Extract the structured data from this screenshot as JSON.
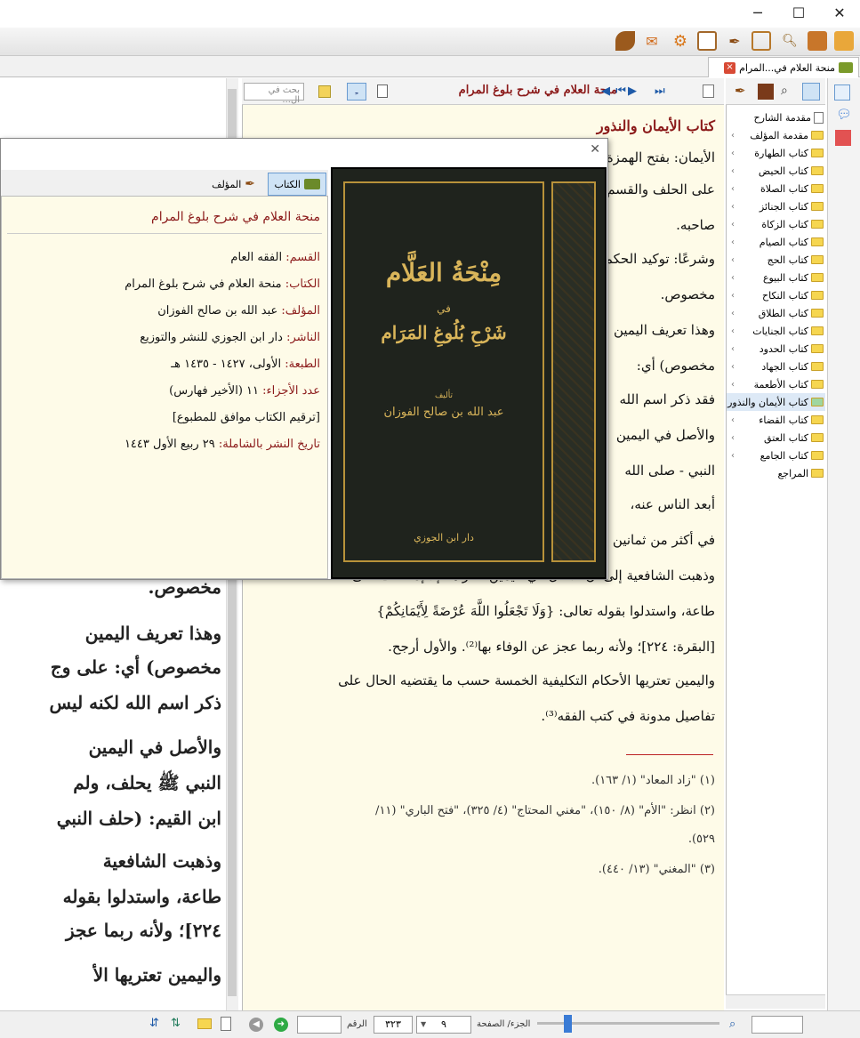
{
  "window": {
    "minimize_glyph": "─",
    "maximize_glyph": "☐",
    "close_glyph": "✕"
  },
  "toolbar": {
    "icons": [
      "book-open-icon",
      "book-icon",
      "search-icon",
      "note-edit-icon",
      "quill-icon",
      "window-list-icon",
      "gear-icon",
      "mail-icon",
      "leaf-icon"
    ]
  },
  "tab": {
    "title": "منحة العلام في...المرام",
    "close_glyph": "×"
  },
  "scan": {
    "lines": [
      "مخصوص.",
      "وهذا تعريف اليمين",
      "مخصوص) أي: على وج",
      "ذكر اسم الله لكنه ليس",
      "والأصل في اليمين",
      "النبي ﷺ يحلف، ولم",
      "ابن القيم: (حلف النبي",
      "وذهبت الشافعية",
      "طاعة، واستدلوا بقوله",
      "٢٢٤]؛ ولأنه ربما عجز",
      "واليمين تعتريها الأ"
    ]
  },
  "nav": {
    "book_title": "منحة العلام في شرح بلوغ المرام",
    "search_placeholder": "بحث في ال..."
  },
  "text": {
    "heading": "كتاب الأيمان والنذور",
    "lines": [
      "الأيمان: بفتح الهمزة",
      "على الحلف والقسم",
      "صاحبه.",
      "وشرعًا: توكيد الحكم",
      "مخصوص.",
      "وهذا تعريف اليمين",
      "مخصوص) أي:",
      "فقد ذكر اسم الله",
      "والأصل في اليمين",
      "النبي - صلى الله",
      "أبعد الناس عنه،",
      "في أكثر من ثمانين",
      "وذهبت الشافعية إلى أن الأصل في اليمين الكراهة إلا إذا كانت على",
      "طاعة، واستدلوا بقوله تعالى: {وَلَا تَجْعَلُوا اللَّهَ عُرْضَةً لِأَيْمَانِكُمْ}",
      "[البقرة: ٢٢٤]؛ ولأنه ربما عجز عن الوفاء بها⁽²⁾. والأول أرجح.",
      "واليمين تعتريها الأحكام التكليفية الخمسة حسب ما يقتضيه الحال على",
      "تفاصيل مدونة في كتب الفقه⁽³⁾."
    ],
    "footnotes": [
      "(١) \"زاد المعاد\" (١/ ١٦٣).",
      "(٢) انظر: \"الأم\" (٨/ ١٥٠)، \"مغني المحتاج\" (٤/ ٣٢٥)، \"فتح الباري\" (١١/",
      "٥٢٩).",
      "(٣) \"المغني\" (١٣/ ٤٤٠)."
    ]
  },
  "tree": {
    "items": [
      {
        "label": "مقدمة الشارح",
        "doc": true
      },
      {
        "label": "مقدمة المؤلف"
      },
      {
        "label": "كتاب الطهارة"
      },
      {
        "label": "كتاب الحيض"
      },
      {
        "label": "كتاب الصلاة"
      },
      {
        "label": "كتاب الجنائز"
      },
      {
        "label": "كتاب الزكاة"
      },
      {
        "label": "كتاب الصيام"
      },
      {
        "label": "كتاب الحج"
      },
      {
        "label": "كتاب البيوع"
      },
      {
        "label": "كتاب النكاح"
      },
      {
        "label": "كتاب الطلاق"
      },
      {
        "label": "كتاب الجنايات"
      },
      {
        "label": "كتاب الحدود"
      },
      {
        "label": "كتاب الجهاد"
      },
      {
        "label": "كتاب الأطعمة"
      },
      {
        "label": "كتاب الأيمان والنذور",
        "selected": true
      },
      {
        "label": "كتاب القضاء"
      },
      {
        "label": "كتاب العتق"
      },
      {
        "label": "كتاب الجامع"
      },
      {
        "label": "المراجع",
        "nochev": true
      }
    ]
  },
  "popup": {
    "tab_book": "الكتاب",
    "tab_author": "المؤلف",
    "title": "منحة العلام في شرح بلوغ المرام",
    "fields": [
      {
        "label": "القسم:",
        "value": "الفقه العام"
      },
      {
        "label": "الكتاب:",
        "value": "منحة العلام في شرح بلوغ المرام"
      },
      {
        "label": "المؤلف:",
        "value": "عبد الله بن صالح الفوزان"
      },
      {
        "label": "الناشر:",
        "value": "دار ابن الجوزي للنشر والتوزيع"
      },
      {
        "label": "الطبعة:",
        "value": "الأولى، ١٤٢٧ - ١٤٣٥ هـ"
      },
      {
        "label": "عدد الأجزاء:",
        "value": "١١ (الأخير فهارس)"
      },
      {
        "label": "",
        "value": "[ترقيم الكتاب موافق للمطبوع]"
      },
      {
        "label": "تاريخ النشر بالشاملة:",
        "value": "٢٩ ربيع الأول ١٤٤٣"
      }
    ],
    "cover": {
      "title_main": "مِنْحَةُ العَلَّام",
      "title_fi": "في",
      "title_sub": "شَرْحِ بُلُوغِ المَرَام",
      "author_pre": "تأليف",
      "author": "عبد الله بن صالح الفوزان",
      "publisher": "دار ابن الجوزي"
    }
  },
  "status": {
    "page_label": "الجزء/ الصفحة",
    "page_value": "٣٢٣",
    "part_value": "٩",
    "number_label": "الرقم",
    "number_value": ""
  },
  "colors": {
    "accent_red": "#8b1a1a",
    "paper": "#fefbe8",
    "folder": "#f6d650"
  }
}
